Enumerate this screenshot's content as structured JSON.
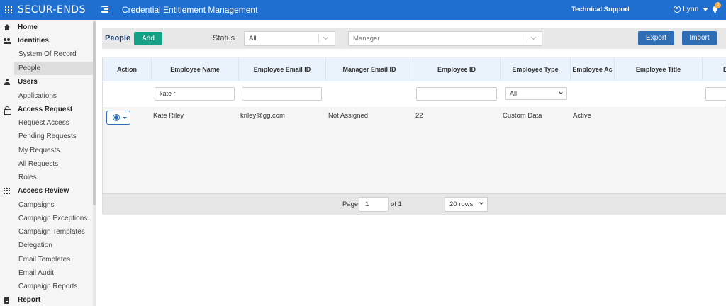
{
  "header": {
    "logo": "SECUR-ENDS",
    "app_title": "Credential Entitlement Management",
    "support_label": "Technical Support",
    "user_name": "Lynn",
    "notification_count": "8",
    "brand_color": "#1f6fd1"
  },
  "sidebar": {
    "items": [
      {
        "label": "Home",
        "type": "section",
        "icon": "home-icon"
      },
      {
        "label": "Identities",
        "type": "section",
        "icon": "people-icon"
      },
      {
        "label": "System Of Record",
        "type": "sub"
      },
      {
        "label": "People",
        "type": "sub",
        "active": true
      },
      {
        "label": "Users",
        "type": "section",
        "icon": "user-icon"
      },
      {
        "label": "Applications",
        "type": "sub"
      },
      {
        "label": "Access Request",
        "type": "section",
        "icon": "lock-icon"
      },
      {
        "label": "Request Access",
        "type": "sub"
      },
      {
        "label": "Pending Requests",
        "type": "sub"
      },
      {
        "label": "My Requests",
        "type": "sub"
      },
      {
        "label": "All Requests",
        "type": "sub"
      },
      {
        "label": "Roles",
        "type": "sub"
      },
      {
        "label": "Access Review",
        "type": "section",
        "icon": "grid-icon"
      },
      {
        "label": "Campaigns",
        "type": "sub"
      },
      {
        "label": "Campaign Exceptions",
        "type": "sub"
      },
      {
        "label": "Campaign Templates",
        "type": "sub"
      },
      {
        "label": "Delegation",
        "type": "sub"
      },
      {
        "label": "Email Templates",
        "type": "sub"
      },
      {
        "label": "Email Audit",
        "type": "sub"
      },
      {
        "label": "Campaign Reports",
        "type": "sub"
      },
      {
        "label": "Report",
        "type": "section",
        "icon": "document-icon"
      }
    ]
  },
  "toolbar": {
    "page_label": "People",
    "add_label": "Add",
    "status_label": "Status",
    "status_value": "All",
    "manager_placeholder": "Manager",
    "export_label": "Export",
    "import_label": "Import"
  },
  "table": {
    "columns": [
      "Action",
      "Employee Name",
      "Employee Email ID",
      "Manager Email ID",
      "Employee ID",
      "Employee Type",
      "Employee Ac",
      "Employee Title",
      "D"
    ],
    "filters": {
      "employee_name": "kate r",
      "employee_type": "All"
    },
    "rows": [
      {
        "name": "Kate Riley",
        "email": "kriley@gg.com",
        "manager": "Not Assigned",
        "id": "22",
        "type": "Custom Data",
        "account": "Active",
        "title": ""
      }
    ]
  },
  "pager": {
    "page_label": "Page",
    "page_value": "1",
    "of_label": "of 1",
    "rows_value": "20 rows"
  }
}
